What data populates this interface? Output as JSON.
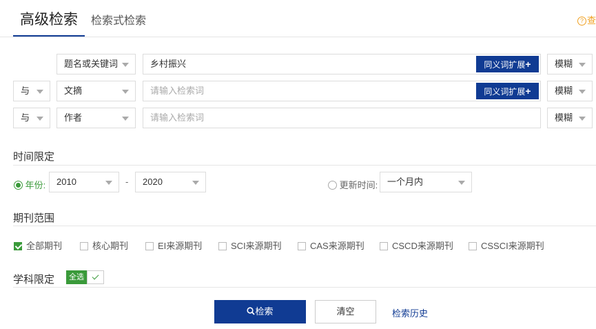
{
  "tabs": {
    "active": "高级检索",
    "inactive": "检索式检索"
  },
  "help": {
    "icon": "?",
    "label": "查"
  },
  "rows": [
    {
      "logic": "",
      "field": "题名或关键词",
      "value": "乡村振兴",
      "placeholder": "",
      "synonym": "同义词扩展",
      "plus": "+",
      "match": "模糊"
    },
    {
      "logic": "与",
      "field": "文摘",
      "value": "",
      "placeholder": "请输入检索词",
      "synonym": "同义词扩展",
      "plus": "+",
      "match": "模糊"
    },
    {
      "logic": "与",
      "field": "作者",
      "value": "",
      "placeholder": "请输入检索词",
      "synonym": "",
      "plus": "",
      "match": "模糊"
    }
  ],
  "time": {
    "title": "时间限定",
    "year_label": "年份:",
    "year_from": "2010",
    "dash": "-",
    "year_to": "2020",
    "update_label": "更新时间:",
    "update_value": "一个月内"
  },
  "journal": {
    "title": "期刊范围",
    "options": [
      "全部期刊",
      "核心期刊",
      "EI来源期刊",
      "SCI来源期刊",
      "CAS来源期刊",
      "CSCD来源期刊",
      "CSSCI来源期刊"
    ]
  },
  "subject": {
    "title": "学科限定",
    "all_label": "全选"
  },
  "actions": {
    "search": "检索",
    "clear": "清空",
    "history": "检索历史"
  },
  "colors": {
    "brand": "#103b93",
    "accent_green": "#3a9a3a",
    "help_orange": "#f0a020"
  }
}
